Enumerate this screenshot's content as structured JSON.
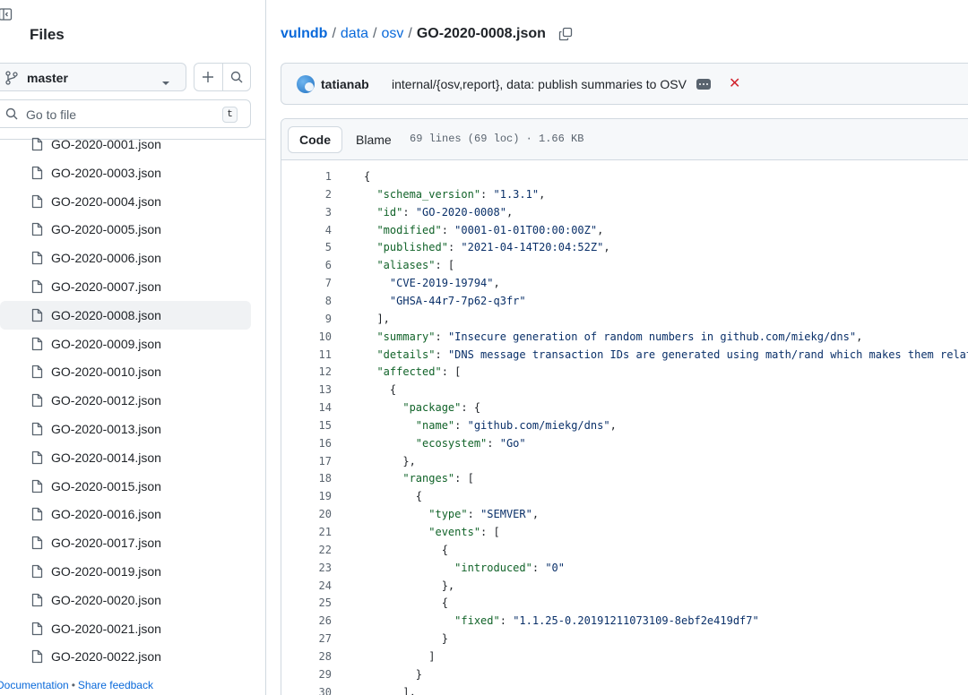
{
  "sidebar": {
    "title": "Files",
    "branch": "master",
    "search_placeholder": "Go to file",
    "search_shortcut": "t",
    "files": [
      "GO-2020-0001.json",
      "GO-2020-0003.json",
      "GO-2020-0004.json",
      "GO-2020-0005.json",
      "GO-2020-0006.json",
      "GO-2020-0007.json",
      "GO-2020-0008.json",
      "GO-2020-0009.json",
      "GO-2020-0010.json",
      "GO-2020-0012.json",
      "GO-2020-0013.json",
      "GO-2020-0014.json",
      "GO-2020-0015.json",
      "GO-2020-0016.json",
      "GO-2020-0017.json",
      "GO-2020-0019.json",
      "GO-2020-0020.json",
      "GO-2020-0021.json",
      "GO-2020-0022.json"
    ],
    "active_file": "GO-2020-0008.json",
    "footer": {
      "documentation": "Documentation",
      "separator": "•",
      "feedback": "Share feedback"
    }
  },
  "breadcrumb": {
    "repo": "vulndb",
    "dir1": "data",
    "dir2": "osv",
    "file": "GO-2020-0008.json",
    "sep": "/"
  },
  "commit": {
    "author": "tatianab",
    "message": "internal/{osv,report}, data: publish summaries to OSV",
    "status": "✕"
  },
  "file_view": {
    "tabs": {
      "code": "Code",
      "blame": "Blame"
    },
    "meta": "69 lines (69 loc) · 1.66 KB"
  },
  "code_lines": [
    [
      [
        "p",
        "{"
      ]
    ],
    [
      [
        "p",
        "  "
      ],
      [
        "k",
        "\"schema_version\""
      ],
      [
        "p",
        ": "
      ],
      [
        "s",
        "\"1.3.1\""
      ],
      [
        "p",
        ","
      ]
    ],
    [
      [
        "p",
        "  "
      ],
      [
        "k",
        "\"id\""
      ],
      [
        "p",
        ": "
      ],
      [
        "s",
        "\"GO-2020-0008\""
      ],
      [
        "p",
        ","
      ]
    ],
    [
      [
        "p",
        "  "
      ],
      [
        "k",
        "\"modified\""
      ],
      [
        "p",
        ": "
      ],
      [
        "s",
        "\"0001-01-01T00:00:00Z\""
      ],
      [
        "p",
        ","
      ]
    ],
    [
      [
        "p",
        "  "
      ],
      [
        "k",
        "\"published\""
      ],
      [
        "p",
        ": "
      ],
      [
        "s",
        "\"2021-04-14T20:04:52Z\""
      ],
      [
        "p",
        ","
      ]
    ],
    [
      [
        "p",
        "  "
      ],
      [
        "k",
        "\"aliases\""
      ],
      [
        "p",
        ": ["
      ]
    ],
    [
      [
        "p",
        "    "
      ],
      [
        "s",
        "\"CVE-2019-19794\""
      ],
      [
        "p",
        ","
      ]
    ],
    [
      [
        "p",
        "    "
      ],
      [
        "s",
        "\"GHSA-44r7-7p62-q3fr\""
      ]
    ],
    [
      [
        "p",
        "  ],"
      ]
    ],
    [
      [
        "p",
        "  "
      ],
      [
        "k",
        "\"summary\""
      ],
      [
        "p",
        ": "
      ],
      [
        "s",
        "\"Insecure generation of random numbers in github.com/miekg/dns\""
      ],
      [
        "p",
        ","
      ]
    ],
    [
      [
        "p",
        "  "
      ],
      [
        "k",
        "\"details\""
      ],
      [
        "p",
        ": "
      ],
      [
        "s",
        "\"DNS message transaction IDs are generated using math/rand which makes them relat"
      ]
    ],
    [
      [
        "p",
        "  "
      ],
      [
        "k",
        "\"affected\""
      ],
      [
        "p",
        ": ["
      ]
    ],
    [
      [
        "p",
        "    {"
      ]
    ],
    [
      [
        "p",
        "      "
      ],
      [
        "k",
        "\"package\""
      ],
      [
        "p",
        ": {"
      ]
    ],
    [
      [
        "p",
        "        "
      ],
      [
        "k",
        "\"name\""
      ],
      [
        "p",
        ": "
      ],
      [
        "s",
        "\"github.com/miekg/dns\""
      ],
      [
        "p",
        ","
      ]
    ],
    [
      [
        "p",
        "        "
      ],
      [
        "k",
        "\"ecosystem\""
      ],
      [
        "p",
        ": "
      ],
      [
        "s",
        "\"Go\""
      ]
    ],
    [
      [
        "p",
        "      },"
      ]
    ],
    [
      [
        "p",
        "      "
      ],
      [
        "k",
        "\"ranges\""
      ],
      [
        "p",
        ": ["
      ]
    ],
    [
      [
        "p",
        "        {"
      ]
    ],
    [
      [
        "p",
        "          "
      ],
      [
        "k",
        "\"type\""
      ],
      [
        "p",
        ": "
      ],
      [
        "s",
        "\"SEMVER\""
      ],
      [
        "p",
        ","
      ]
    ],
    [
      [
        "p",
        "          "
      ],
      [
        "k",
        "\"events\""
      ],
      [
        "p",
        ": ["
      ]
    ],
    [
      [
        "p",
        "            {"
      ]
    ],
    [
      [
        "p",
        "              "
      ],
      [
        "k",
        "\"introduced\""
      ],
      [
        "p",
        ": "
      ],
      [
        "s",
        "\"0\""
      ]
    ],
    [
      [
        "p",
        "            },"
      ]
    ],
    [
      [
        "p",
        "            {"
      ]
    ],
    [
      [
        "p",
        "              "
      ],
      [
        "k",
        "\"fixed\""
      ],
      [
        "p",
        ": "
      ],
      [
        "s",
        "\"1.1.25-0.20191211073109-8ebf2e419df7\""
      ]
    ],
    [
      [
        "p",
        "            }"
      ]
    ],
    [
      [
        "p",
        "          ]"
      ]
    ],
    [
      [
        "p",
        "        }"
      ]
    ],
    [
      [
        "p",
        "      ],"
      ]
    ]
  ],
  "colors": {
    "link": "#0969da",
    "key": "#116329",
    "string": "#0a3069",
    "border": "#d1d9e0",
    "error": "#d1242f"
  }
}
